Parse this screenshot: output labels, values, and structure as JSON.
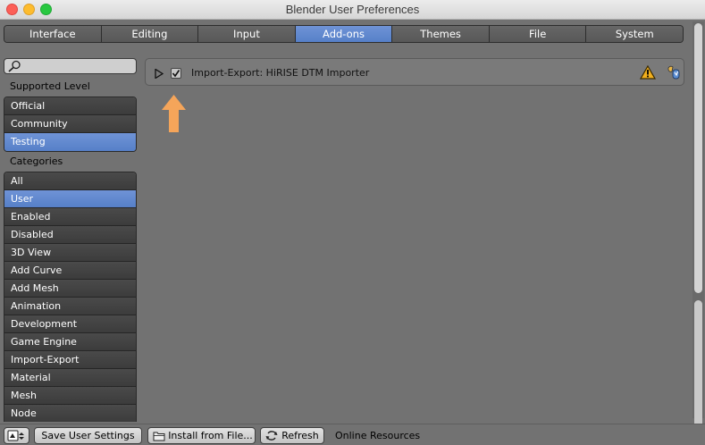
{
  "window": {
    "title": "Blender User Preferences"
  },
  "tabs": [
    {
      "label": "Interface",
      "active": false
    },
    {
      "label": "Editing",
      "active": false
    },
    {
      "label": "Input",
      "active": false
    },
    {
      "label": "Add-ons",
      "active": true
    },
    {
      "label": "Themes",
      "active": false
    },
    {
      "label": "File",
      "active": false
    },
    {
      "label": "System",
      "active": false
    }
  ],
  "sidebar": {
    "search": {
      "value": "",
      "icon": "magnifier-icon"
    },
    "supported_level_label": "Supported Level",
    "support_levels": [
      {
        "label": "Official",
        "active": false
      },
      {
        "label": "Community",
        "active": false
      },
      {
        "label": "Testing",
        "active": true
      }
    ],
    "categories_label": "Categories",
    "categories": [
      {
        "label": "All",
        "active": false
      },
      {
        "label": "User",
        "active": true
      },
      {
        "label": "Enabled",
        "active": false
      },
      {
        "label": "Disabled",
        "active": false
      },
      {
        "label": "3D View",
        "active": false
      },
      {
        "label": "Add Curve",
        "active": false
      },
      {
        "label": "Add Mesh",
        "active": false
      },
      {
        "label": "Animation",
        "active": false
      },
      {
        "label": "Development",
        "active": false
      },
      {
        "label": "Game Engine",
        "active": false
      },
      {
        "label": "Import-Export",
        "active": false
      },
      {
        "label": "Material",
        "active": false
      },
      {
        "label": "Mesh",
        "active": false
      },
      {
        "label": "Node",
        "active": false
      }
    ]
  },
  "addons": [
    {
      "name": "Import-Export: HiRISE DTM Importer",
      "enabled": true,
      "expanded": false,
      "warning_icon": "warning-icon",
      "user_icon": "user-addon-icon"
    }
  ],
  "bottom_bar": {
    "save_label": "Save User Settings",
    "install_label": "Install from File...",
    "refresh_label": "Refresh",
    "online_resources_label": "Online Resources"
  },
  "colors": {
    "accent": "#5a84cb",
    "annotation_arrow": "#f5a55a",
    "background": "#727272"
  }
}
